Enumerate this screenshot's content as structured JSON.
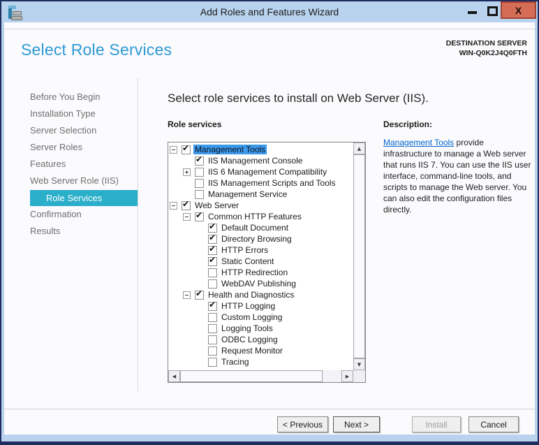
{
  "window": {
    "title": "Add Roles and Features Wizard"
  },
  "icons": {
    "close": "X",
    "check": "✔",
    "arrow_up": "▲",
    "arrow_down": "▼",
    "arrow_left": "◀",
    "arrow_right": "▶"
  },
  "colors": {
    "titlebar": "#b9d3ee",
    "frame_border": "#1d2b5e",
    "close_button": "#d56c55",
    "heading_blue": "#2e9bd6",
    "sidebar_selected": "#2aaec9",
    "tree_selection": "#3d9aeb",
    "link": "#0066cc"
  },
  "header": {
    "title": "Select Role Services",
    "destination_label": "DESTINATION SERVER",
    "destination_server": "WIN-Q0K2J4Q0FTH"
  },
  "sidebar": {
    "items": [
      {
        "label": "Before You Begin",
        "selected": false
      },
      {
        "label": "Installation Type",
        "selected": false
      },
      {
        "label": "Server Selection",
        "selected": false
      },
      {
        "label": "Server Roles",
        "selected": false
      },
      {
        "label": "Features",
        "selected": false
      },
      {
        "label": "Web Server Role (IIS)",
        "selected": false
      },
      {
        "label": "Role Services",
        "selected": true
      },
      {
        "label": "Confirmation",
        "selected": false
      },
      {
        "label": "Results",
        "selected": false
      }
    ]
  },
  "main": {
    "instruction": "Select role services to install on Web Server (IIS).",
    "tree_label": "Role services",
    "tree": {
      "rows": [
        {
          "label": "Management Tools",
          "level": 0,
          "expander": "minus",
          "checked": true,
          "selected": true
        },
        {
          "label": "IIS Management Console",
          "level": 1,
          "expander": null,
          "checked": true,
          "selected": false
        },
        {
          "label": "IIS 6 Management Compatibility",
          "level": 1,
          "expander": "plus",
          "checked": false,
          "selected": false
        },
        {
          "label": "IIS Management Scripts and Tools",
          "level": 1,
          "expander": null,
          "checked": false,
          "selected": false
        },
        {
          "label": "Management Service",
          "level": 1,
          "expander": null,
          "checked": false,
          "selected": false
        },
        {
          "label": "Web Server",
          "level": 0,
          "expander": "minus",
          "checked": true,
          "selected": false
        },
        {
          "label": "Common HTTP Features",
          "level": 1,
          "expander": "minus",
          "checked": true,
          "selected": false
        },
        {
          "label": "Default Document",
          "level": 2,
          "expander": null,
          "checked": true,
          "selected": false
        },
        {
          "label": "Directory Browsing",
          "level": 2,
          "expander": null,
          "checked": true,
          "selected": false
        },
        {
          "label": "HTTP Errors",
          "level": 2,
          "expander": null,
          "checked": true,
          "selected": false
        },
        {
          "label": "Static Content",
          "level": 2,
          "expander": null,
          "checked": true,
          "selected": false
        },
        {
          "label": "HTTP Redirection",
          "level": 2,
          "expander": null,
          "checked": false,
          "selected": false
        },
        {
          "label": "WebDAV Publishing",
          "level": 2,
          "expander": null,
          "checked": false,
          "selected": false
        },
        {
          "label": "Health and Diagnostics",
          "level": 1,
          "expander": "minus",
          "checked": true,
          "selected": false
        },
        {
          "label": "HTTP Logging",
          "level": 2,
          "expander": null,
          "checked": true,
          "selected": false
        },
        {
          "label": "Custom Logging",
          "level": 2,
          "expander": null,
          "checked": false,
          "selected": false
        },
        {
          "label": "Logging Tools",
          "level": 2,
          "expander": null,
          "checked": false,
          "selected": false
        },
        {
          "label": "ODBC Logging",
          "level": 2,
          "expander": null,
          "checked": false,
          "selected": false
        },
        {
          "label": "Request Monitor",
          "level": 2,
          "expander": null,
          "checked": false,
          "selected": false
        },
        {
          "label": "Tracing",
          "level": 2,
          "expander": null,
          "checked": false,
          "selected": false
        }
      ]
    }
  },
  "description": {
    "heading": "Description:",
    "link_text": "Management Tools",
    "text": " provide infrastructure to manage a Web server that runs IIS 7. You can use the IIS user interface, command-line tools, and scripts to manage the Web server. You can also edit the configuration files directly."
  },
  "footer": {
    "buttons": [
      {
        "label": "< Previous",
        "enabled": true,
        "default": false
      },
      {
        "label": "Next >",
        "enabled": true,
        "default": true
      },
      {
        "label": "Install",
        "enabled": false,
        "default": false
      },
      {
        "label": "Cancel",
        "enabled": true,
        "default": false
      }
    ]
  }
}
